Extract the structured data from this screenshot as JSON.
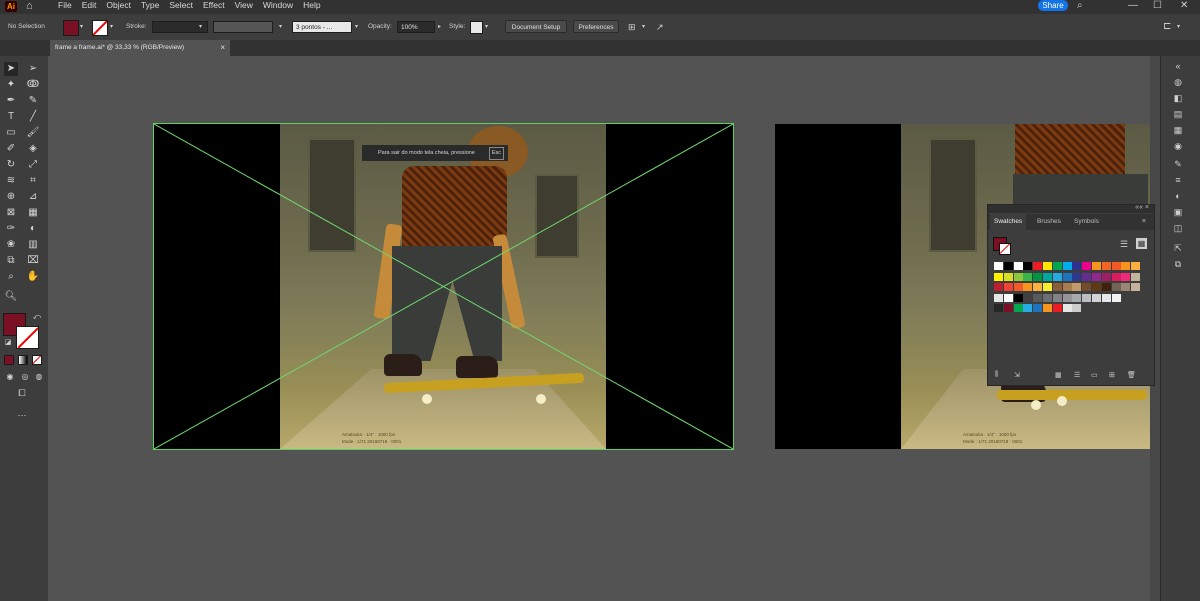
{
  "app": {
    "logo": "Ai"
  },
  "menu": [
    "File",
    "Edit",
    "Object",
    "Type",
    "Select",
    "Effect",
    "View",
    "Window",
    "Help"
  ],
  "share_label": "Share",
  "control": {
    "selection": "No Selection",
    "stroke_label": "Stroke:",
    "brush_value": "3 pontos - ...",
    "opacity_label": "Opacity:",
    "opacity_value": "100%",
    "style_label": "Style:",
    "doc_setup": "Document Setup",
    "preferences": "Preferences",
    "fill_color": "#7a1024"
  },
  "tab": {
    "title": "frame a frame.ai* @ 33,33 % (RGB/Preview)",
    "close": "×"
  },
  "tooltip": {
    "text": "Para sair do modo tela cheia, pressione",
    "key": "Esc"
  },
  "stamp": {
    "line1": "Amatsuka ·  1/4\" · 1000 fps",
    "line2": "Mode · 1/71          20160718 · 0001"
  },
  "panel": {
    "tabs": [
      "Swatches",
      "Brushes",
      "Symbols"
    ],
    "menu_icon": "≡",
    "collapse": "««  ×"
  },
  "icons": {
    "tools": [
      "selection-arrow",
      "direct-select",
      "magic-wand",
      "lasso",
      "pen",
      "curvature",
      "type",
      "line",
      "rectangle",
      "paintbrush",
      "shaper",
      "eraser",
      "rotate",
      "scale",
      "warp",
      "free-transform",
      "shape-builder",
      "perspective",
      "mesh",
      "gradient",
      "eyedropper",
      "blend",
      "symbol-sprayer",
      "column-graph",
      "artboard",
      "slice",
      "hand",
      "zoom"
    ]
  },
  "swatch_colors": [
    [
      "#ffffff",
      "#000000",
      "#ffffff",
      "#000000",
      "#ed1c24",
      "#ffe600",
      "#00a650",
      "#00adef",
      "#2e3192",
      "#ec008c",
      "#f7941d",
      "#f26522",
      "#f15a24",
      "#f7941d",
      "#fbb040"
    ],
    [
      "#fff200",
      "#d7df23",
      "#8dc63f",
      "#39b54a",
      "#009444",
      "#00a79d",
      "#27aae1",
      "#1c75bc",
      "#2b3990",
      "#662d91",
      "#92278f",
      "#9e1f63",
      "#da1c5c",
      "#ee2a7b",
      "#c2b59b"
    ],
    [
      "#be1e2d",
      "#ef4136",
      "#f15a29",
      "#f7941d",
      "#fbb040",
      "#f9ed32",
      "#8a5d3b",
      "#a97c50",
      "#c49a6c",
      "#754c29",
      "#603913",
      "#42210b",
      "#736357",
      "#998675",
      "#c7b299"
    ],
    [
      "#e6e6e6",
      "#ffffff",
      "#000000",
      "#414042",
      "#58595b",
      "#6d6e71",
      "#808285",
      "#939598",
      "#a7a9ac",
      "#bcbec0",
      "#d1d3d4",
      "#e6e7e8",
      "#f1f2f2"
    ],
    [
      "#262626",
      "#7a1024",
      "#00a650",
      "#27aae1",
      "#1c75bc",
      "#f7941d",
      "#ed1c24",
      "#e6e6e6",
      "#cccccc"
    ]
  ]
}
